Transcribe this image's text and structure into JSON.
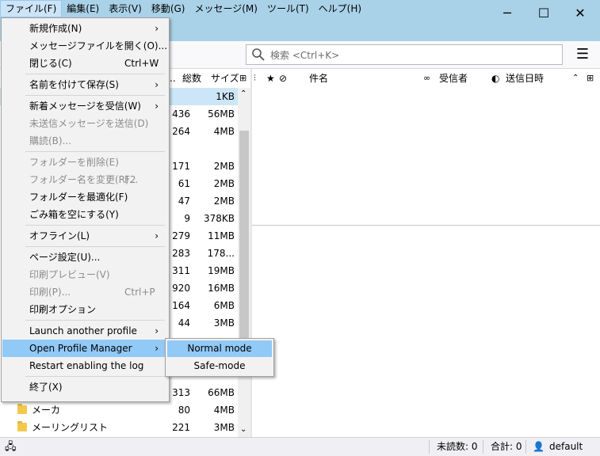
{
  "menubar": {
    "items": [
      "ファイル(F)",
      "編集(E)",
      "表示(V)",
      "移動(G)",
      "メッセージ(M)",
      "ツール(T)",
      "ヘルプ(H)"
    ]
  },
  "window": {
    "minimize": "─",
    "maximize": "☐",
    "close": "✕"
  },
  "search": {
    "placeholder": "検索 <Ctrl+K>"
  },
  "folder_header": {
    "col_name_fragment": "..",
    "col_total": "総数",
    "col_size": "サイズ"
  },
  "folder_rows": [
    {
      "name": "",
      "count": "",
      "size": "1KB",
      "selected": true
    },
    {
      "name": "",
      "count": "436",
      "size": "56MB"
    },
    {
      "name": "",
      "count": "264",
      "size": "4MB"
    },
    {
      "name": "",
      "count": "",
      "size": ""
    },
    {
      "name": "",
      "count": "171",
      "size": "2MB"
    },
    {
      "name": "",
      "count": "61",
      "size": "2MB"
    },
    {
      "name": "",
      "count": "47",
      "size": "2MB"
    },
    {
      "name": "",
      "count": "9",
      "size": "378KB"
    },
    {
      "name": "",
      "count": "279",
      "size": "11MB"
    },
    {
      "name": "",
      "count": "283",
      "size": "178..."
    },
    {
      "name": "",
      "count": "311",
      "size": "19MB"
    },
    {
      "name": "",
      "count": "920",
      "size": "16MB"
    },
    {
      "name": "",
      "count": "164",
      "size": "6MB"
    },
    {
      "name": "",
      "count": "44",
      "size": "3MB"
    },
    {
      "name": "",
      "count": "",
      "size": ""
    },
    {
      "name": "",
      "count": "",
      "size": ""
    },
    {
      "name": "",
      "count": "",
      "size": ""
    },
    {
      "name": "",
      "count": "313",
      "size": "66MB"
    },
    {
      "name": "メーカ",
      "count": "80",
      "size": "4MB"
    },
    {
      "name": "メーリングリスト",
      "count": "221",
      "size": "3MB"
    }
  ],
  "thread_header": {
    "subject": "件名",
    "sender": "受信者",
    "date": "送信日時"
  },
  "file_menu": [
    {
      "label": "新規作成(N)",
      "submenu": true
    },
    {
      "label": "メッセージファイルを開く(O)..."
    },
    {
      "label": "閉じる(C)",
      "accel": "Ctrl+W"
    },
    {
      "sep": true
    },
    {
      "label": "名前を付けて保存(S)",
      "submenu": true
    },
    {
      "sep": true
    },
    {
      "label": "新着メッセージを受信(W)",
      "submenu": true
    },
    {
      "label": "未送信メッセージを送信(D)",
      "disabled": true
    },
    {
      "label": "購読(B)...",
      "disabled": true
    },
    {
      "sep": true
    },
    {
      "label": "フォルダーを削除(E)",
      "disabled": true
    },
    {
      "label": "フォルダー名を変更(R)...",
      "accel": "F2",
      "disabled": true
    },
    {
      "label": "フォルダーを最適化(F)"
    },
    {
      "label": "ごみ箱を空にする(Y)"
    },
    {
      "sep": true
    },
    {
      "label": "オフライン(L)",
      "submenu": true
    },
    {
      "sep": true
    },
    {
      "label": "ページ設定(U)..."
    },
    {
      "label": "印刷プレビュー(V)",
      "disabled": true
    },
    {
      "label": "印刷(P)...",
      "accel": "Ctrl+P",
      "disabled": true
    },
    {
      "label": "印刷オプション"
    },
    {
      "sep": true
    },
    {
      "label": "Launch another profile",
      "submenu": true
    },
    {
      "label": "Open Profile Manager",
      "submenu": true,
      "highlighted": true
    },
    {
      "label": "Restart enabling the log"
    },
    {
      "sep": true
    },
    {
      "label": "終了(X)"
    }
  ],
  "sub_menu": [
    {
      "label": "Normal mode",
      "highlighted": true
    },
    {
      "label": "Safe-mode"
    }
  ],
  "status": {
    "unread": "未読数: 0",
    "total": "合計: 0",
    "profile": "default"
  },
  "colors": {
    "titlebar": "#a9d2e8",
    "highlight": "#91c9f7",
    "menu_bg": "#f2f2f2"
  }
}
